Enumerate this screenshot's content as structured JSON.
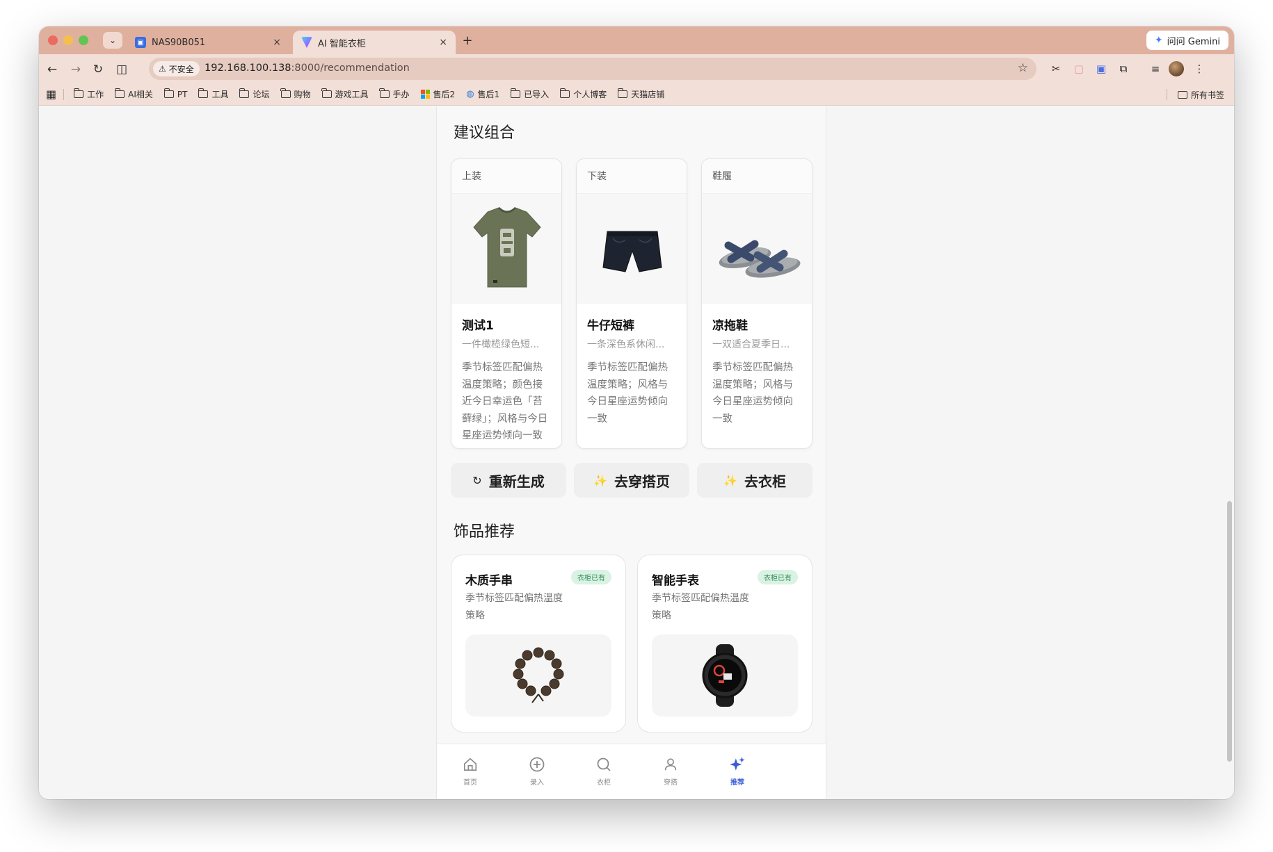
{
  "browser": {
    "tabs": [
      {
        "title": "NAS90B051",
        "close": "×"
      },
      {
        "title": "AI 智能衣柜",
        "close": "×"
      }
    ],
    "new_tab": "+",
    "gemini_label": "问问 Gemini",
    "security_label": "不安全",
    "url_host": "192.168.100.138",
    "url_path": ":8000/recommendation",
    "bookmarks": [
      "工作",
      "AI相关",
      "PT",
      "工具",
      "论坛",
      "购物",
      "游戏工具",
      "手办",
      "售后2",
      "售后1",
      "已导入",
      "个人博客",
      "天猫店铺"
    ],
    "bookmarks_all": "所有书签"
  },
  "app": {
    "suggest_title": "建议组合",
    "outfit": [
      {
        "category": "上装",
        "name": "测试1",
        "desc": "一件橄榄绿色短...",
        "reason": "季节标签匹配偏热温度策略；颜色接近今日幸运色「苔藓绿」；风格与今日星座运势倾向一致"
      },
      {
        "category": "下装",
        "name": "牛仔短裤",
        "desc": "一条深色系休闲...",
        "reason": "季节标签匹配偏热温度策略；风格与今日星座运势倾向一致"
      },
      {
        "category": "鞋履",
        "name": "凉拖鞋",
        "desc": "一双适合夏季日...",
        "reason": "季节标签匹配偏热温度策略；风格与今日星座运势倾向一致"
      }
    ],
    "actions": {
      "regenerate": "重新生成",
      "go_outfit": "去穿搭页",
      "go_closet": "去衣柜"
    },
    "accessory_title": "饰品推荐",
    "accessories": [
      {
        "name": "木质手串",
        "badge": "衣柜已有",
        "reason": "季节标签匹配偏热温度策略"
      },
      {
        "name": "智能手表",
        "badge": "衣柜已有",
        "reason": "季节标签匹配偏热温度策略"
      }
    ],
    "nav": {
      "home": "首页",
      "add": "录入",
      "closet": "衣柜",
      "outfit": "穿搭",
      "recommend": "推荐"
    },
    "colors": {
      "accent": "#3a5ed8",
      "tab_bar": "#e0b09e",
      "badge_bg": "#d9f2e3",
      "badge_text": "#2e8b57"
    }
  }
}
